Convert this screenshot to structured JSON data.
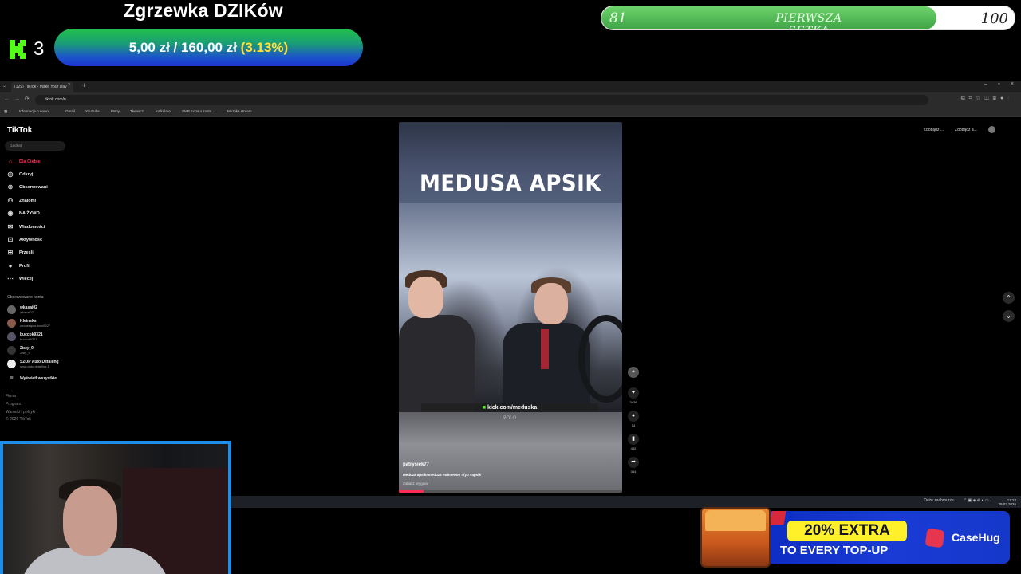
{
  "overlay": {
    "goal_title": "Zgrzewka DZIKów",
    "kick_count": "3",
    "goal_amount": "5,00 zł / 160,00 zł",
    "goal_percent": "(3.13%)",
    "setka": {
      "start": "81",
      "label": "PIERWSZA SETKA",
      "end": "100",
      "progress": 0.81
    }
  },
  "browser": {
    "tab_title": "(129) TikTok - Make Your Day",
    "url": "tiktok.com/n",
    "bookmarks": [
      "Informacje o nowo...",
      "Gmail",
      "YouTube",
      "Mapy",
      "Tłumacz",
      "Kalkulator",
      "SMP Kupa o zosta...",
      "Muzyka stream"
    ]
  },
  "tiktok": {
    "logo": "TikTok",
    "search_placeholder": "Szukaj",
    "nav": [
      {
        "label": "Dla Ciebie",
        "icon": "home-icon"
      },
      {
        "label": "Odkryj",
        "icon": "compass-icon"
      },
      {
        "label": "Obserwowani",
        "icon": "following-icon"
      },
      {
        "label": "Znajomi",
        "icon": "friends-icon"
      },
      {
        "label": "NA ŻYWO",
        "icon": "live-icon"
      },
      {
        "label": "Wiadomości",
        "icon": "messages-icon"
      },
      {
        "label": "Aktywność",
        "icon": "activity-icon"
      },
      {
        "label": "Prześlij",
        "icon": "upload-icon"
      },
      {
        "label": "Profil",
        "icon": "profile-icon"
      },
      {
        "label": "Więcej",
        "icon": "more-icon"
      }
    ],
    "followed_heading": "Obserwowane konta",
    "accounts": [
      {
        "name": "wkasai02",
        "sub": "wkasai02"
      },
      {
        "name": "Kleineks",
        "sub": "zbooesqcoutoos9627"
      },
      {
        "name": "buccok9321",
        "sub": "buccok9321"
      },
      {
        "name": "2isty_9",
        "sub": "2isty_9"
      },
      {
        "name": "SZOP Auto Detailing",
        "sub": "szop.auto.detailing.1"
      },
      {
        "name": "Wyświetl wszystkie",
        "sub": ""
      }
    ],
    "footer": [
      "Firma",
      "Program",
      "Warunki i polityki",
      "© 2026 TikTok"
    ],
    "top_actions": [
      "Zdobądź ...",
      "Zdobądź a..."
    ],
    "video": {
      "title": "MEDUSA APSIK",
      "kick_prefix": "kick.com/",
      "kick_channel": "meduska",
      "watermark": "ROLO",
      "username": "patrysiek77",
      "caption": "Meduza apsik#meduza #wimeowy #fyp #apsik",
      "sound": "Zobacz oryginał",
      "progress": 0.11
    },
    "rail": [
      {
        "icon": "avatar-follow-icon",
        "count": ""
      },
      {
        "icon": "heart-icon",
        "count": "3426"
      },
      {
        "icon": "comment-icon",
        "count": "14"
      },
      {
        "icon": "bookmark-icon",
        "count": "432"
      },
      {
        "icon": "share-icon",
        "count": "364"
      }
    ]
  },
  "taskbar": {
    "weather": "Duże zachmurze...",
    "time": "17:23",
    "date": "29.03.2026"
  },
  "ad": {
    "headline": "20% EXTRA",
    "subline": "TO EVERY TOP-UP",
    "brand": "CaseHug"
  }
}
